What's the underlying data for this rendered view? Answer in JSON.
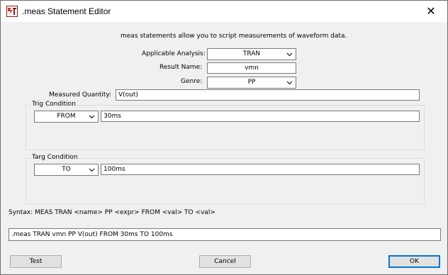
{
  "window": {
    "title": ".meas Statement Editor",
    "close_glyph": "✕"
  },
  "intro": "meas statements allow you to script measurements of waveform data.",
  "form": {
    "analysis_label": "Applicable Analysis:",
    "analysis_value": "TRAN",
    "result_label": "Result Name:",
    "result_value": "vmn",
    "genre_label": "Genre:",
    "genre_value": "PP",
    "quantity_label": "Measured Quantity:",
    "quantity_value": "V(out)"
  },
  "trig": {
    "label": "Trig Condition",
    "mode": "FROM",
    "value": "30ms"
  },
  "targ": {
    "label": "Targ Condition",
    "mode": "TO",
    "value": "100ms"
  },
  "syntax": "Syntax:  MEAS TRAN <name> PP <expr> FROM <val> TO <val>",
  "statement": ".meas TRAN vmn PP V(out) FROM 30ms TO 100ms",
  "buttons": {
    "test": "Test",
    "cancel": "Cancel",
    "ok": "OK"
  },
  "icons": {
    "app": "ltspice-app-icon",
    "dropdown": "chevron-down-icon",
    "close": "close-icon"
  }
}
